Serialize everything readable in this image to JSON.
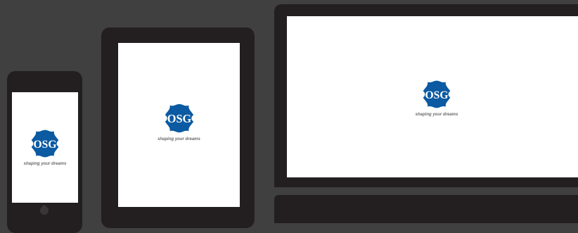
{
  "colors": {
    "background": "#404040",
    "device_frame": "#231f20",
    "screen": "#ffffff",
    "logo_blue": "#0b5aa2",
    "tagline": "#6b6b6b"
  },
  "logo": {
    "monogram": "OSG",
    "tagline": "shaping your dreams",
    "icon": "osg-gear-logo"
  },
  "devices": [
    {
      "type": "phone"
    },
    {
      "type": "tablet"
    },
    {
      "type": "laptop"
    }
  ]
}
